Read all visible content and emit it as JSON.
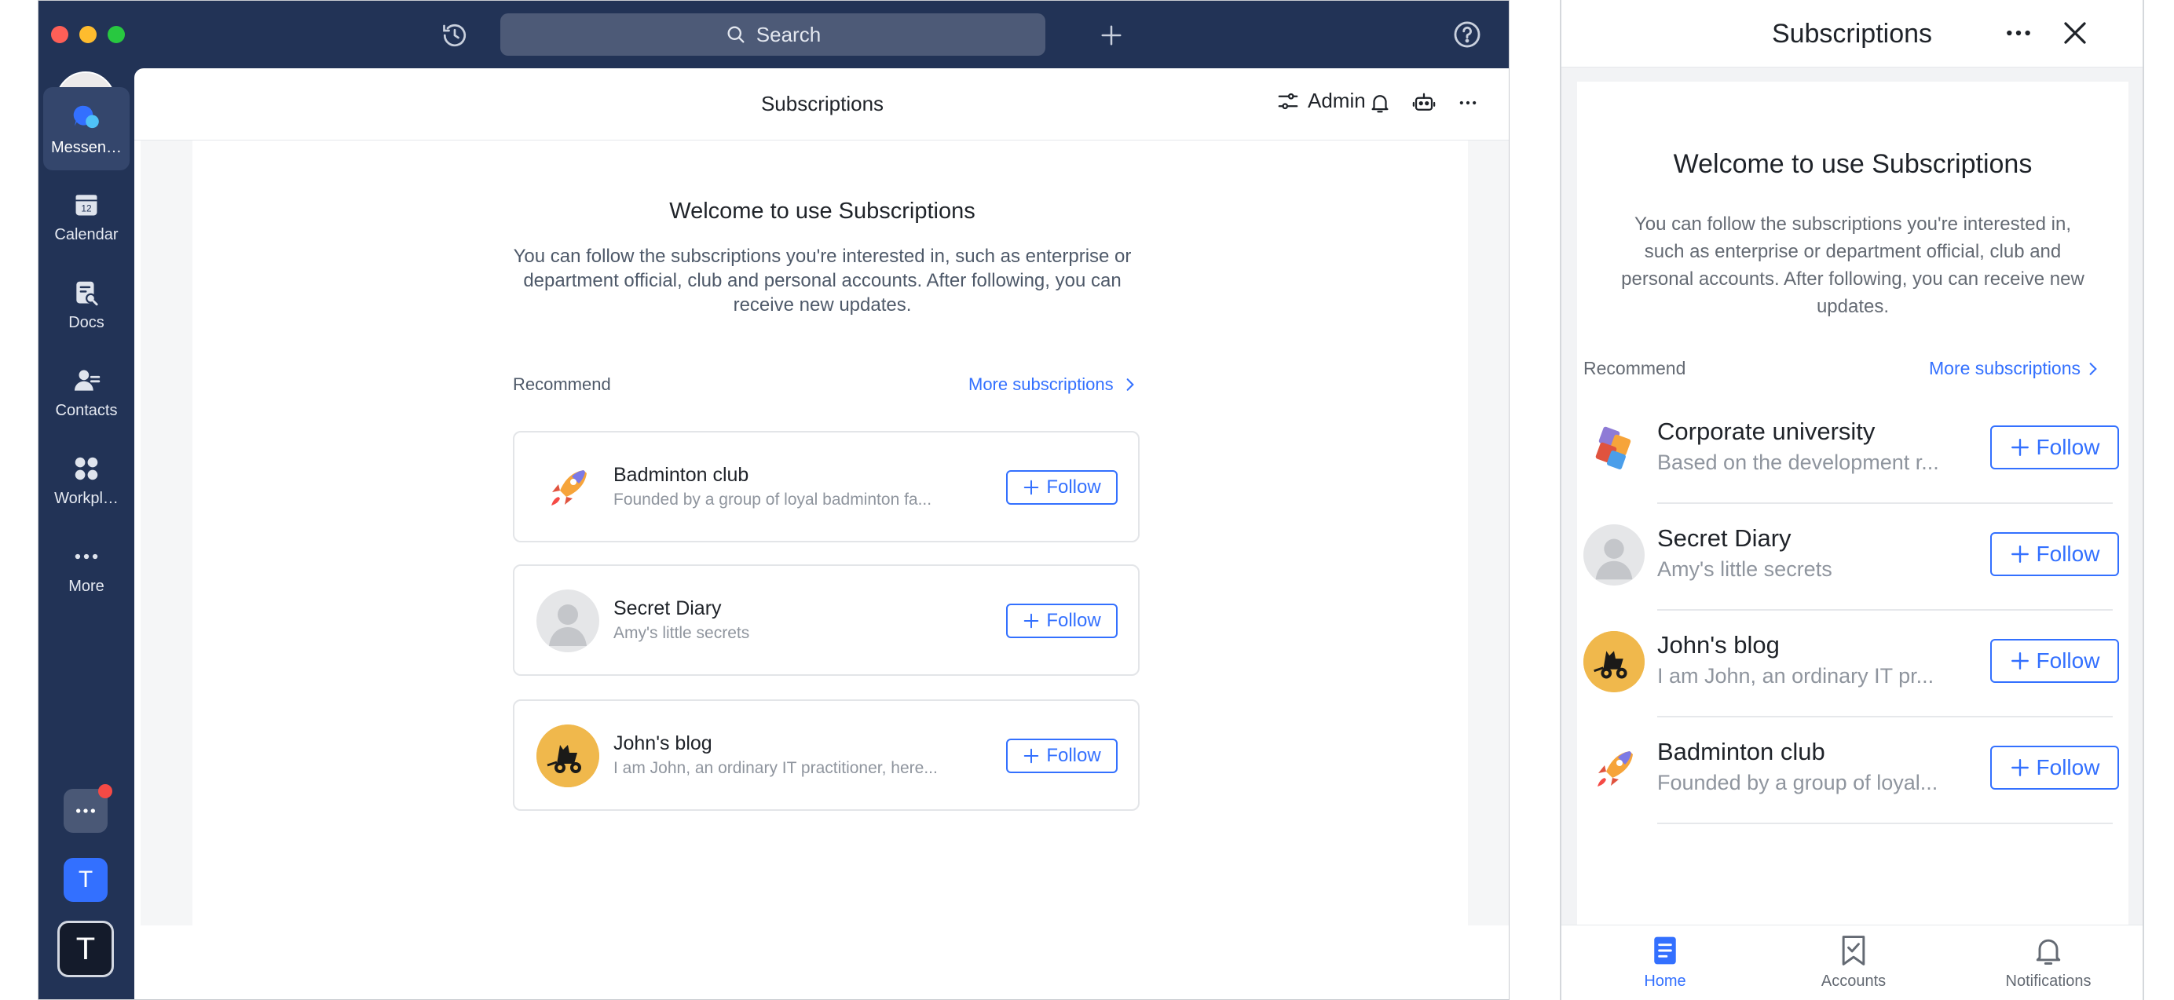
{
  "desktop": {
    "search": {
      "placeholder": "Search"
    },
    "sidebar": {
      "items": [
        {
          "label": "Messen…",
          "icon": "messenger-icon",
          "active": true
        },
        {
          "label": "Calendar",
          "icon": "calendar-icon",
          "calendar_day": "12"
        },
        {
          "label": "Docs",
          "icon": "docs-icon"
        },
        {
          "label": "Contacts",
          "icon": "contacts-icon"
        },
        {
          "label": "Workpl…",
          "icon": "workplace-icon"
        },
        {
          "label": "More",
          "icon": "more-icon"
        }
      ],
      "dock": [
        {
          "label": "",
          "icon": "more-apps-icon",
          "badge": true
        },
        {
          "label": "T",
          "icon": "app-t-icon"
        },
        {
          "label": "T",
          "icon": "app-t-dark-icon"
        }
      ]
    },
    "header": {
      "title": "Subscriptions",
      "admin_label": "Admin"
    },
    "welcome": {
      "title": "Welcome to use Subscriptions",
      "description": "You can follow the subscriptions you're interested in, such as enterprise or department official, club and personal accounts. After following, you can receive new updates."
    },
    "recommend": {
      "label": "Recommend",
      "more_label": "More subscriptions"
    },
    "cards": [
      {
        "name": "Badminton club",
        "desc": "Founded by a group of loyal badminton fa...",
        "icon": "rocket-icon",
        "follow_label": "Follow"
      },
      {
        "name": "Secret Diary",
        "desc": "Amy's little secrets",
        "icon": "person-placeholder-icon",
        "follow_label": "Follow"
      },
      {
        "name": "John's blog",
        "desc": "I am John, an ordinary IT practitioner, here...",
        "icon": "wheelchair-cat-icon",
        "follow_label": "Follow"
      }
    ]
  },
  "mobile": {
    "header": {
      "title": "Subscriptions"
    },
    "welcome": {
      "title": "Welcome to use Subscriptions",
      "description": "You can follow the subscriptions you're interested in, such as enterprise or department official, club and personal accounts. After following, you can receive new updates."
    },
    "recommend": {
      "label": "Recommend",
      "more_label": "More subscriptions"
    },
    "items": [
      {
        "name": "Corporate university",
        "desc": "Based on the development r...",
        "icon": "corporate-university-icon",
        "follow_label": "Follow"
      },
      {
        "name": "Secret Diary",
        "desc": "Amy's little secrets",
        "icon": "person-placeholder-icon",
        "follow_label": "Follow"
      },
      {
        "name": "John's blog",
        "desc": "I am John, an ordinary IT pr...",
        "icon": "wheelchair-cat-icon",
        "follow_label": "Follow"
      },
      {
        "name": "Badminton club",
        "desc": "Founded by a group of loyal...",
        "icon": "rocket-icon",
        "follow_label": "Follow"
      }
    ],
    "tabs": [
      {
        "label": "Home",
        "icon": "home-doc-icon",
        "active": true
      },
      {
        "label": "Accounts",
        "icon": "bookmark-check-icon",
        "active": false
      },
      {
        "label": "Notifications",
        "icon": "bell-icon",
        "active": false
      }
    ]
  },
  "colors": {
    "accent": "#3370ff",
    "sidebar": "#223356",
    "badge": "#f54a45"
  }
}
